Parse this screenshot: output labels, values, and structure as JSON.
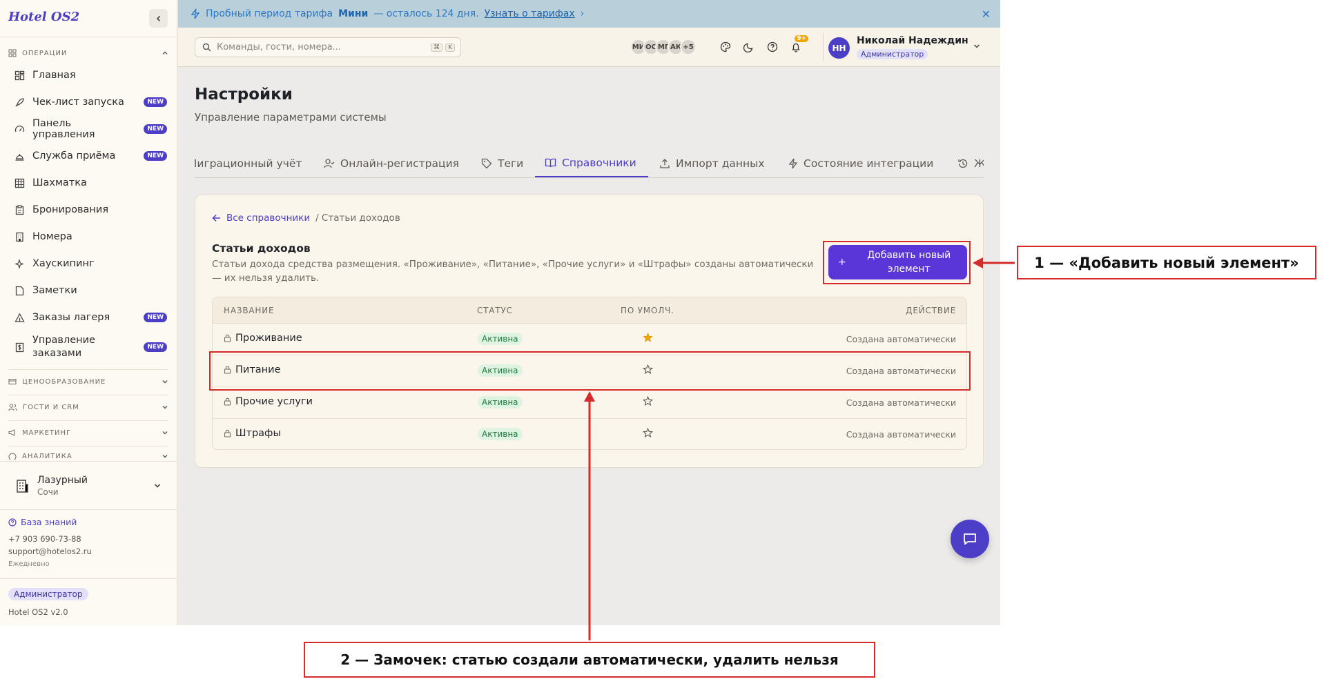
{
  "app": {
    "brand": "Hotel OS2"
  },
  "sidebar": {
    "operations_label": "ОПЕРАЦИИ",
    "items": [
      {
        "label": "Главная",
        "badge": ""
      },
      {
        "label": "Чек-лист запуска",
        "badge": "NEW"
      },
      {
        "label": "Панель управления",
        "badge": "NEW"
      },
      {
        "label": "Служба приёма",
        "badge": "NEW"
      },
      {
        "label": "Шахматка",
        "badge": ""
      },
      {
        "label": "Бронирования",
        "badge": ""
      },
      {
        "label": "Номера",
        "badge": ""
      },
      {
        "label": "Хаускипинг",
        "badge": ""
      },
      {
        "label": "Заметки",
        "badge": ""
      },
      {
        "label": "Заказы лагеря",
        "badge": "NEW"
      },
      {
        "label": "Управление заказами",
        "badge": "NEW"
      }
    ],
    "sections": [
      "ЦЕНООБРАЗОВАНИЕ",
      "ГОСТИ И CRM",
      "МАРКЕТИНГ",
      "АНАЛИТИКА"
    ],
    "property": {
      "name": "Лазурный",
      "city": "Сочи"
    },
    "knowledge_base": "База знаний",
    "phone": "+7 903 690-73-88",
    "email": "support@hotelos2.ru",
    "schedule": "Ежедневно",
    "role": "Администратор",
    "version": "Hotel OS2 v2.0"
  },
  "banner": {
    "text_before": "Пробный период тарифа",
    "plan": "Мини",
    "text_after": "— осталось 124 дня.",
    "link": "Узнать о тарифах",
    "link_arrow": "›",
    "close": "✕"
  },
  "topbar": {
    "search_placeholder": "Команды, гости, номера...",
    "kbd1": "⌘",
    "kbd2": "K",
    "avatars": [
      "МИ",
      "ОС",
      "МГ",
      "АК",
      "+5"
    ],
    "notif_count": "9+",
    "user_initials": "НН",
    "user_name": "Николай Надеждин",
    "user_role": "Администратор"
  },
  "page": {
    "title": "Настройки",
    "subtitle": "Управление параметрами системы",
    "tabs": [
      {
        "label": "Миграционный учёт"
      },
      {
        "label": "Онлайн-регистрация"
      },
      {
        "label": "Теги"
      },
      {
        "label": "Справочники"
      },
      {
        "label": "Импорт данных"
      },
      {
        "label": "Состояние интеграции"
      },
      {
        "label": "Журнал"
      }
    ],
    "active_tab": "Справочники"
  },
  "card": {
    "breadcrumb_back": "Все справочники",
    "breadcrumb_current": "/ Статьи доходов",
    "title": "Статьи доходов",
    "description": "Статьи дохода средства размещения. «Проживание», «Питание», «Прочие услуги» и «Штрафы» созданы автоматически — их нельзя удалить.",
    "add_button_icon": "+",
    "add_button": "Добавить новый элемент",
    "columns": [
      "НАЗВАНИЕ",
      "СТАТУС",
      "ПО УМОЛЧ.",
      "ДЕЙСТВИЕ"
    ],
    "rows": [
      {
        "name": "Проживание",
        "status": "Активна",
        "is_default": true,
        "action": "Создана автоматически"
      },
      {
        "name": "Питание",
        "status": "Активна",
        "is_default": false,
        "action": "Создана автоматически"
      },
      {
        "name": "Прочие услуги",
        "status": "Активна",
        "is_default": false,
        "action": "Создана автоматически"
      },
      {
        "name": "Штрафы",
        "status": "Активна",
        "is_default": false,
        "action": "Создана автоматически"
      }
    ]
  },
  "annotations": {
    "note1": "1 — «Добавить новый элемент»",
    "note2": "2 — Замочек: статью создали автоматически, удалить нельзя"
  },
  "colors": {
    "accent": "#4c3ec7",
    "button": "#5a36d8",
    "annotation": "#d62b2b",
    "star_filled": "#f0a500"
  }
}
